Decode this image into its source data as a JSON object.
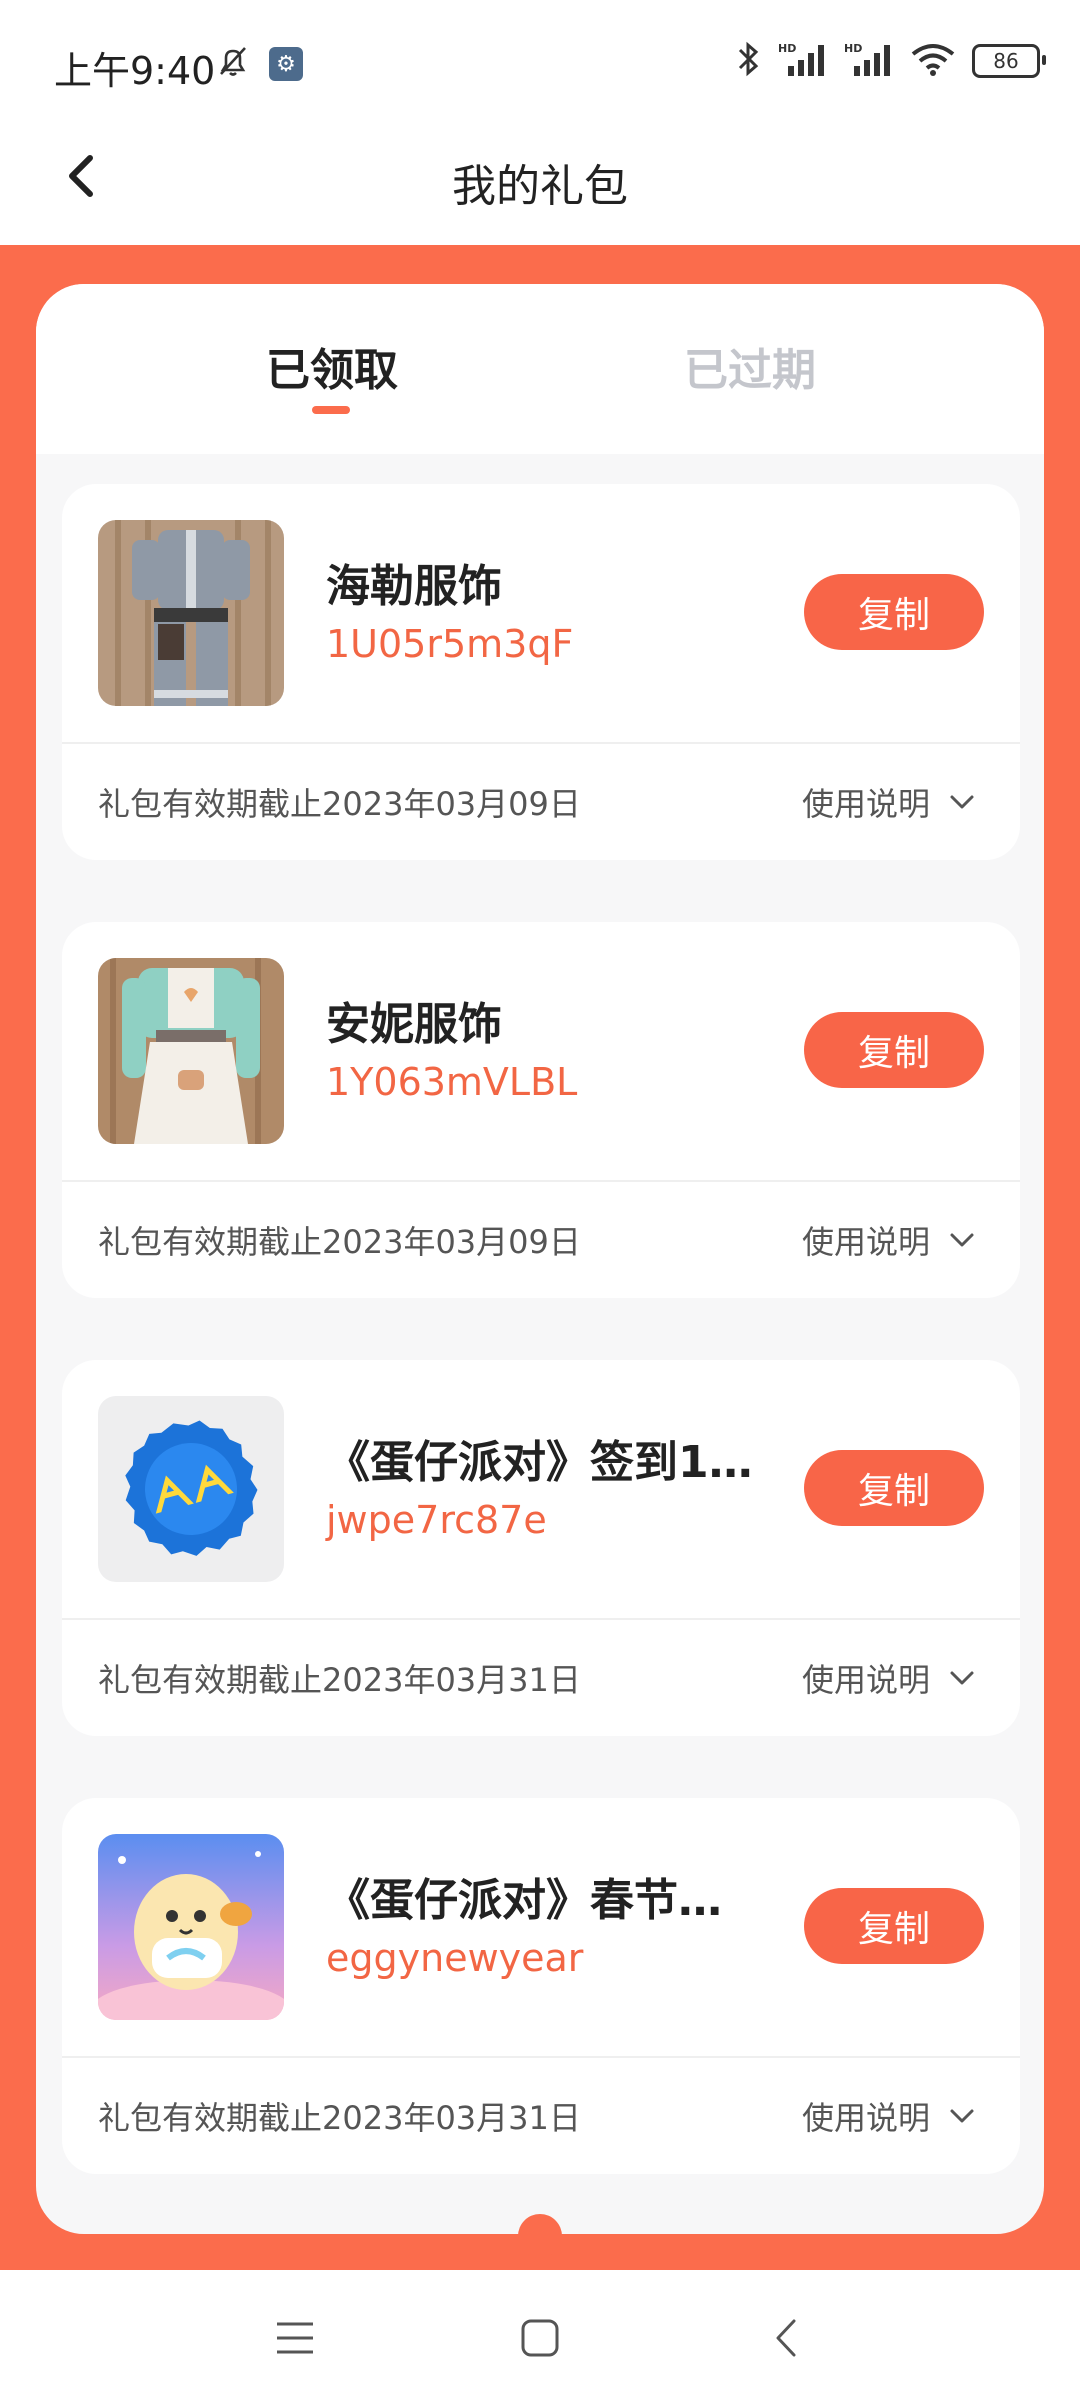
{
  "status_bar": {
    "time": "上午9:40",
    "battery": "86",
    "icons": [
      "mute-bell-icon",
      "settings-gear-icon",
      "bluetooth-icon",
      "signal-hd-icon",
      "signal-hd-icon",
      "wifi-icon",
      "battery-icon"
    ]
  },
  "header": {
    "title": "我的礼包",
    "back_icon": "chevron-left-icon"
  },
  "tabs": [
    {
      "label": "已领取",
      "active": true
    },
    {
      "label": "已过期",
      "active": false
    }
  ],
  "cards": [
    {
      "name": "海勒服饰",
      "code": "1U05r5m3qF",
      "copy_label": "复制",
      "expiry": "礼包有效期截止2023年03月09日",
      "howto_label": "使用说明",
      "thumb": "outfit-grey-image"
    },
    {
      "name": "安妮服饰",
      "code": "1Y063mVLBL",
      "copy_label": "复制",
      "expiry": "礼包有效期截止2023年03月09日",
      "howto_label": "使用说明",
      "thumb": "outfit-mint-dress-image"
    },
    {
      "name": "《蛋仔派对》签到1...",
      "code": "jwpe7rc87e",
      "copy_label": "复制",
      "expiry": "礼包有效期截止2023年03月31日",
      "howto_label": "使用说明",
      "thumb": "blue-bottle-cap-image"
    },
    {
      "name": "《蛋仔派对》春节礼包",
      "code": "eggynewyear",
      "copy_label": "复制",
      "expiry": "礼包有效期截止2023年03月31日",
      "howto_label": "使用说明",
      "thumb": "eggy-character-image"
    }
  ],
  "colors": {
    "accent": "#fb6c4c",
    "code_text": "#f26644"
  },
  "nav_bar": {
    "icons": [
      "menu-icon",
      "home-square-icon",
      "back-triangle-icon"
    ]
  }
}
